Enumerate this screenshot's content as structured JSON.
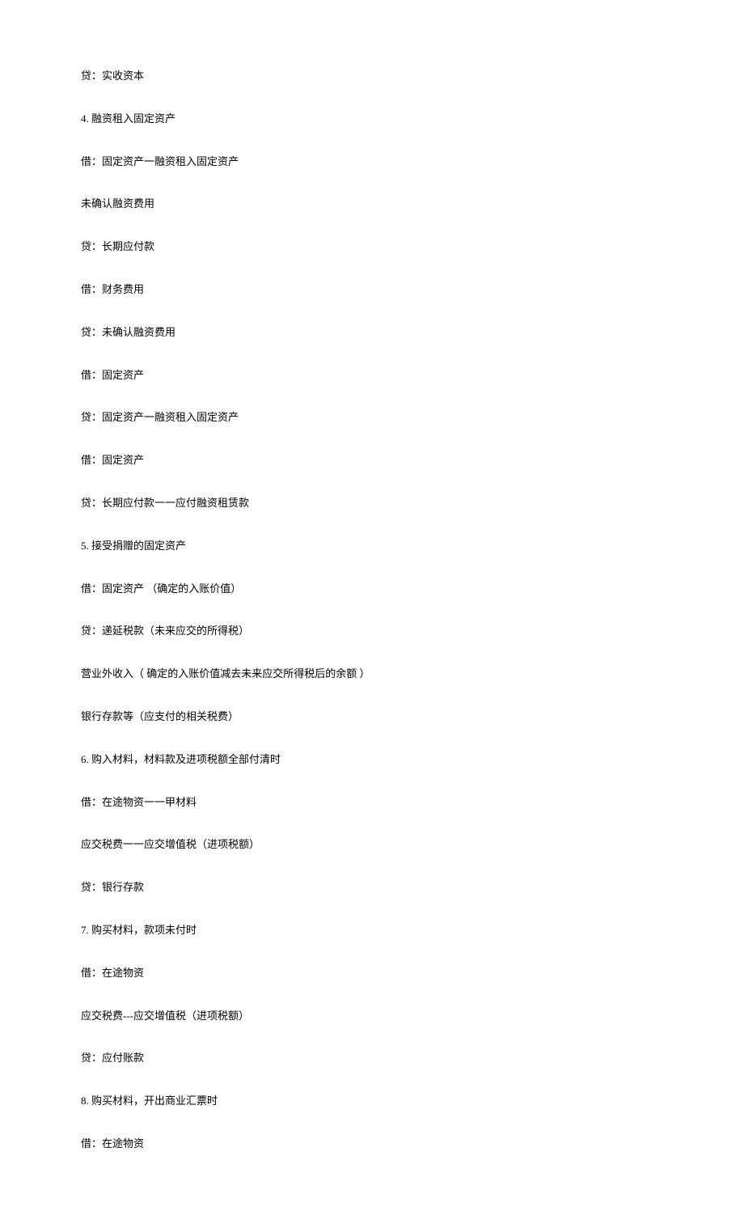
{
  "lines": [
    "贷：实收资本",
    "4.  融资租入固定资产",
    "借：固定资产一融资租入固定资产",
    "未确认融资费用",
    "贷：长期应付款",
    "借：财务费用",
    "贷：未确认融资费用",
    "借：固定资产",
    "贷：固定资产一融资租入固定资产",
    "借：固定资产",
    "贷：长期应付款一一应付融资租赁款",
    "5.  接受捐赠的固定资产",
    "借：固定资产 （确定的入账价值）",
    "贷：递延税款（未来应交的所得税）",
    "营业外收入（ 确定的入账价值减去未来应交所得税后的余额 ）",
    "银行存款等（应支付的相关税费）",
    "6.  购入材料，材料款及进项税额全部付清时",
    "借：在途物资一一甲材料",
    "应交税费一一应交增值税（进项税额）",
    "贷：银行存款",
    "7.  购买材料，款项未付时",
    "借：在途物资",
    "应交税费---应交增值税（进项税额）",
    "贷：应付账款",
    "8.  购买材料，开出商业汇票时",
    "借：在途物资"
  ]
}
